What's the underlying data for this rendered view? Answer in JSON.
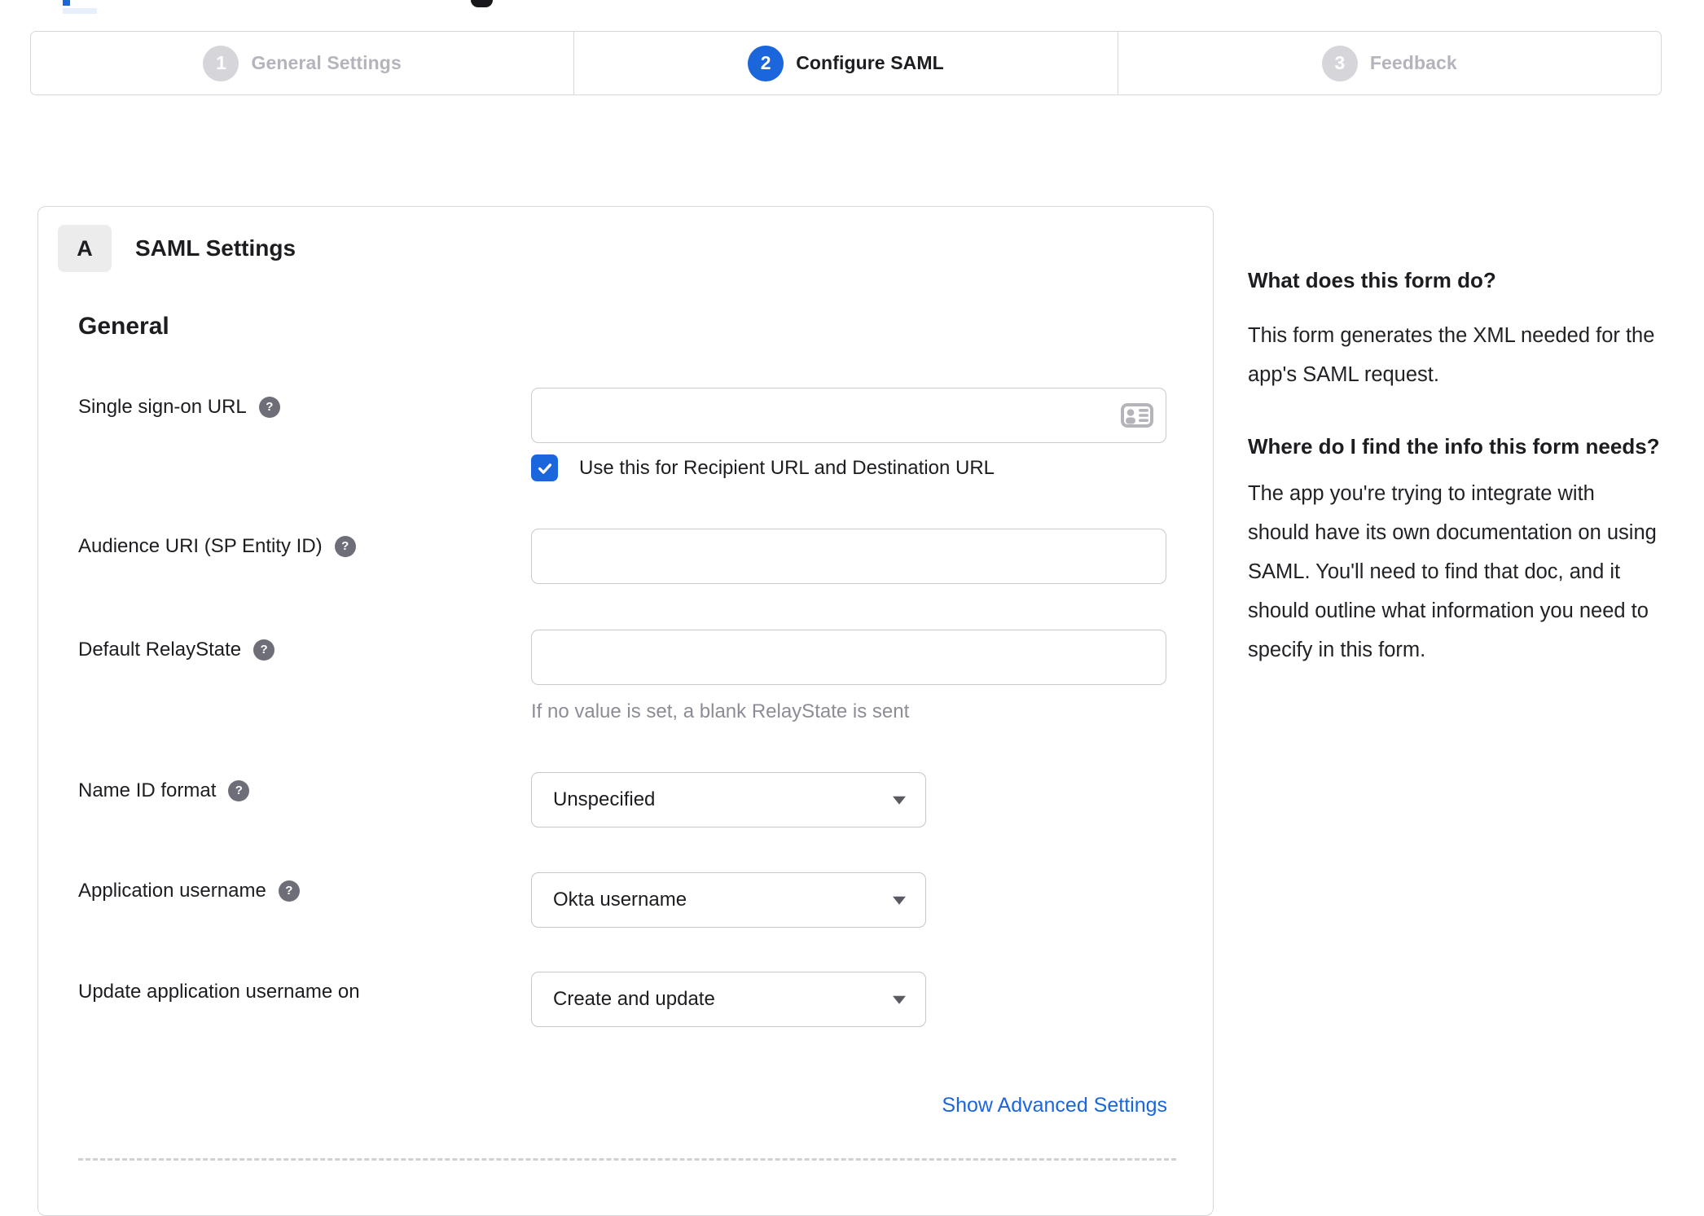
{
  "colors": {
    "accent_blue": "#1b66dd",
    "inactive_step_circle": "#d5d5da",
    "inactive_step_text": "#b4b4bc",
    "text": "#1d1d21",
    "panel_border": "#d7d7db",
    "input_border": "#c9c9cf",
    "muted_text": "#8c8c96",
    "help_icon_bg": "#6e6e78",
    "badge_bg": "#ececed",
    "card_icon_gray": "#b4b4ba"
  },
  "icons": {
    "help_glyph": "?"
  },
  "stepper": {
    "steps": [
      {
        "number": "1",
        "label": "General Settings",
        "active": false
      },
      {
        "number": "2",
        "label": "Configure SAML",
        "active": true
      },
      {
        "number": "3",
        "label": "Feedback",
        "active": false
      }
    ]
  },
  "panel": {
    "badge": "A",
    "title": "SAML Settings",
    "section_heading": "General",
    "fields": [
      {
        "label": "Single sign-on URL",
        "has_help": true,
        "type": "text",
        "value": "",
        "trailing_icon": "contact-card",
        "checkbox_label": "Use this for Recipient URL and Destination URL",
        "checkbox_checked": true
      },
      {
        "label": "Audience URI (SP Entity ID)",
        "has_help": true,
        "type": "text",
        "value": ""
      },
      {
        "label": "Default RelayState",
        "has_help": true,
        "type": "text",
        "value": "",
        "helper_text": "If no value is set, a blank RelayState is sent"
      },
      {
        "label": "Name ID format",
        "has_help": true,
        "type": "select",
        "value": "Unspecified"
      },
      {
        "label": "Application username",
        "has_help": true,
        "type": "select",
        "value": "Okta username"
      },
      {
        "label": "Update application username on",
        "has_help": false,
        "type": "select",
        "value": "Create and update"
      }
    ],
    "advanced_settings_link": "Show Advanced Settings"
  },
  "sidebar": {
    "blocks": [
      {
        "heading": "What does this form do?",
        "body": "This form generates the XML needed for the app's SAML request."
      },
      {
        "heading": "Where do I find the info this form needs?",
        "body": "The app you're trying to integrate with should have its own documentation on using SAML. You'll need to find that doc, and it should outline what information you need to specify in this form."
      }
    ]
  }
}
